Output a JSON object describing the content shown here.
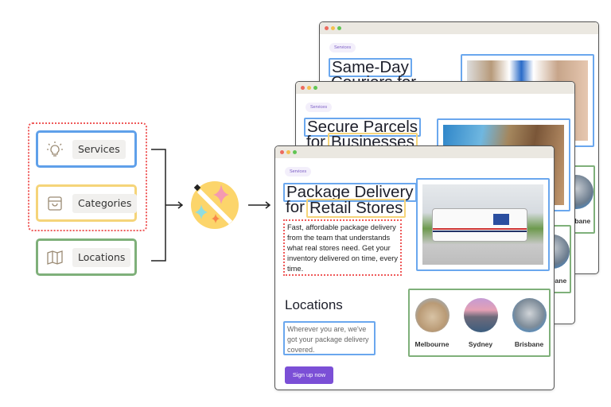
{
  "inputs": [
    {
      "label": "Services",
      "icon": "lightbulb-icon",
      "color": "#5fa0ea"
    },
    {
      "label": "Categories",
      "icon": "shopping-bag-icon",
      "color": "#f5d479"
    },
    {
      "label": "Locations",
      "icon": "map-icon",
      "color": "#7fb07a"
    }
  ],
  "group_border_color": "#ef5a5a",
  "generator_icon": "magic-wand-sparkles-icon",
  "windows": {
    "back": {
      "badge": "Services",
      "title_line1": "Same-Day",
      "title_line2": "Couriers for",
      "location_label": "Brisbane"
    },
    "middle": {
      "badge": "Services",
      "title_line1": "Secure Parcels",
      "title_for": "for",
      "title_highlight": "Businesses",
      "location_label": "Brisbane"
    },
    "front": {
      "badge": "Services",
      "title_line1": "Package Delivery",
      "title_for": "for",
      "title_highlight": "Retail Stores",
      "description": "Fast, affordable package delivery from the team that understands what real stores need. Get your inventory delivered on time, every time.",
      "locations_heading": "Locations",
      "locations_text": "Wherever you are, we've got your package delivery covered.",
      "cities": [
        "Melbourne",
        "Sydney",
        "Brisbane"
      ],
      "cta": "Sign up now",
      "cta_color": "#7b4fd6"
    }
  }
}
